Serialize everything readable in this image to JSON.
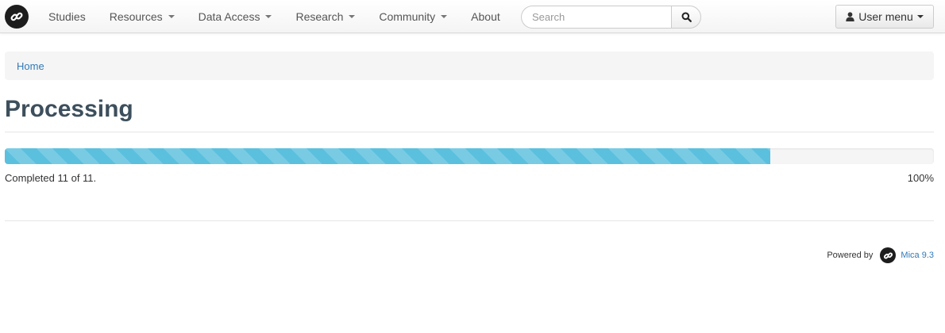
{
  "navbar": {
    "brand_icon": "mica-link-icon",
    "items": [
      {
        "label": "Studies",
        "dropdown": false
      },
      {
        "label": "Resources",
        "dropdown": true
      },
      {
        "label": "Data Access",
        "dropdown": true
      },
      {
        "label": "Research",
        "dropdown": true
      },
      {
        "label": "Community",
        "dropdown": true
      },
      {
        "label": "About",
        "dropdown": false
      }
    ],
    "search": {
      "placeholder": "Search",
      "value": "",
      "icon": "search-icon"
    },
    "user_menu": {
      "label": "User menu",
      "icon": "user-icon"
    }
  },
  "breadcrumb": {
    "items": [
      "Home"
    ]
  },
  "page": {
    "title": "Processing"
  },
  "progress": {
    "status_text": "Completed 11 of 11.",
    "percent_label": "100%",
    "bar_fill_fraction": 0.824,
    "bar_color": "#5bc0de"
  },
  "footer": {
    "powered_by": "Powered by",
    "product_link": "Mica 9.3",
    "logo_icon": "mica-link-icon"
  },
  "colors": {
    "link": "#337ab7",
    "title": "#3d4f5c",
    "progress_track": "#f5f5f5"
  }
}
